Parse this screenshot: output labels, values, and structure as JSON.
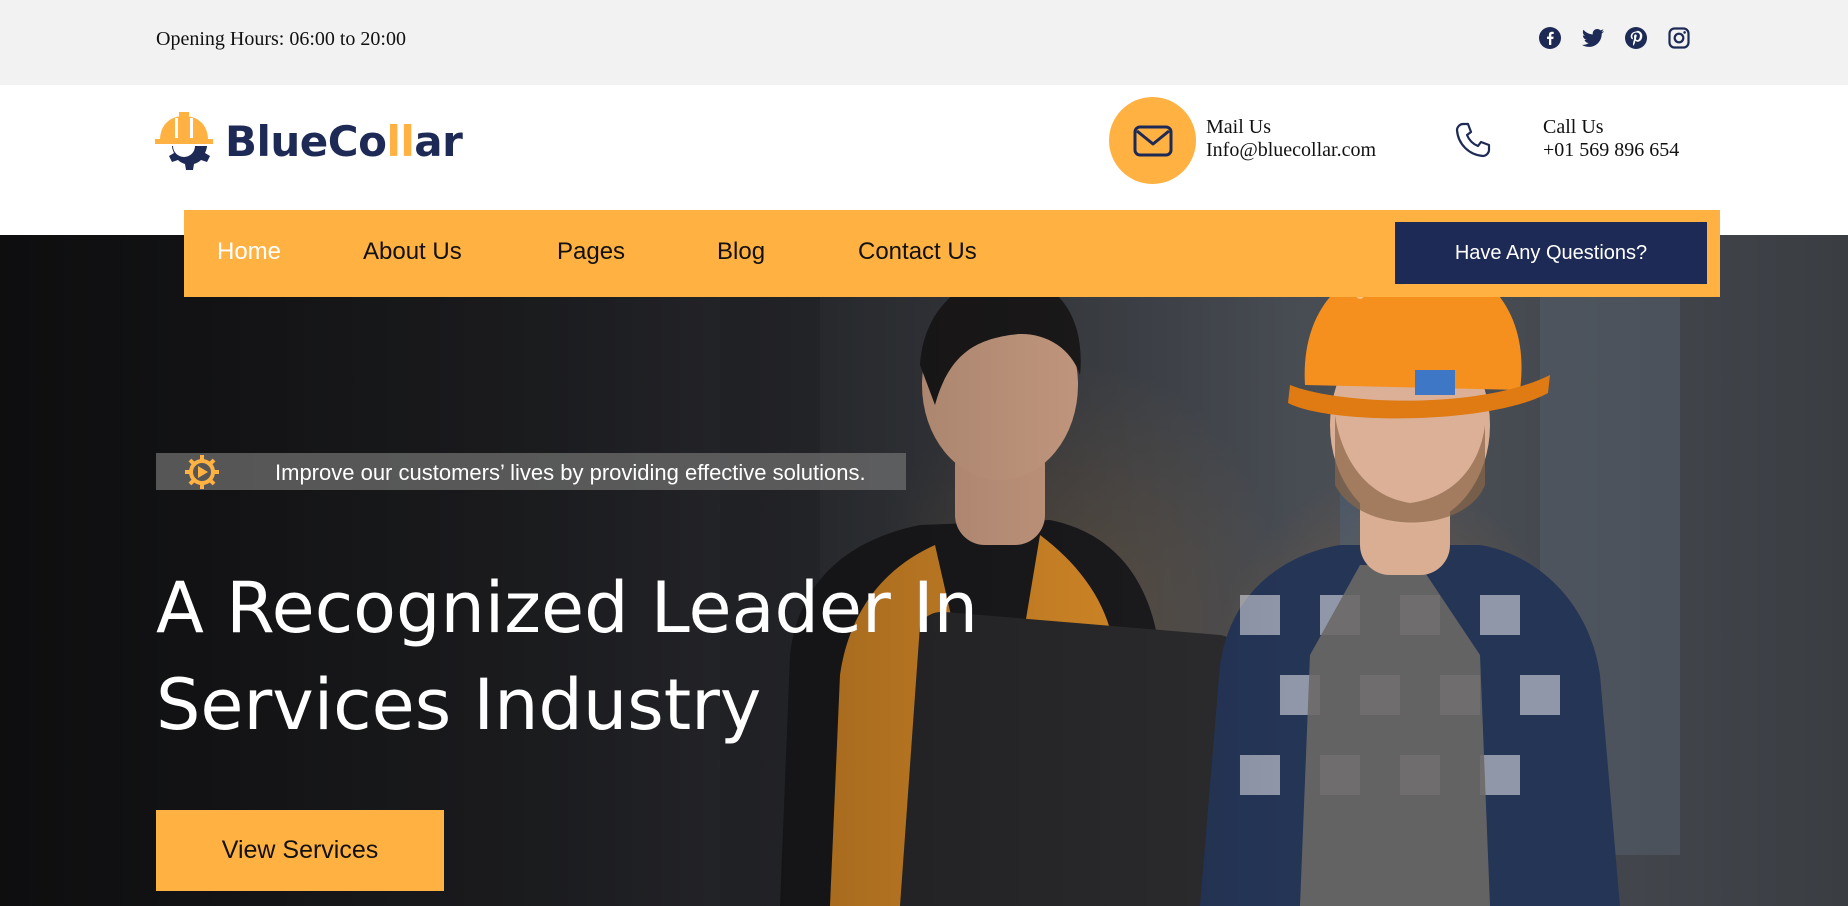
{
  "topbar": {
    "hours": "Opening Hours: 06:00 to 20:00",
    "socials": [
      "facebook-icon",
      "twitter-icon",
      "pinterest-icon",
      "instagram-icon"
    ]
  },
  "header": {
    "logo_part1": "BlueCo",
    "logo_part2": "ll",
    "logo_part3": "ar",
    "mail_label": "Mail Us",
    "mail_value": "Info@bluecollar.com",
    "call_label": "Call Us",
    "call_value": "+01 569 896 654"
  },
  "nav": {
    "items": [
      "Home",
      "About Us",
      "Pages",
      "Blog",
      "Contact Us"
    ],
    "active": "Home",
    "cta": "Have Any Questions?"
  },
  "hero": {
    "tagline": "Improve our customers’ lives by providing effective solutions.",
    "title_line1": "A Recognized Leader In",
    "title_line2": "Services Industry",
    "button": "View Services"
  },
  "colors": {
    "accent": "#ffb142",
    "navy": "#1e2a56",
    "topbar_bg": "#f2f2f2"
  }
}
